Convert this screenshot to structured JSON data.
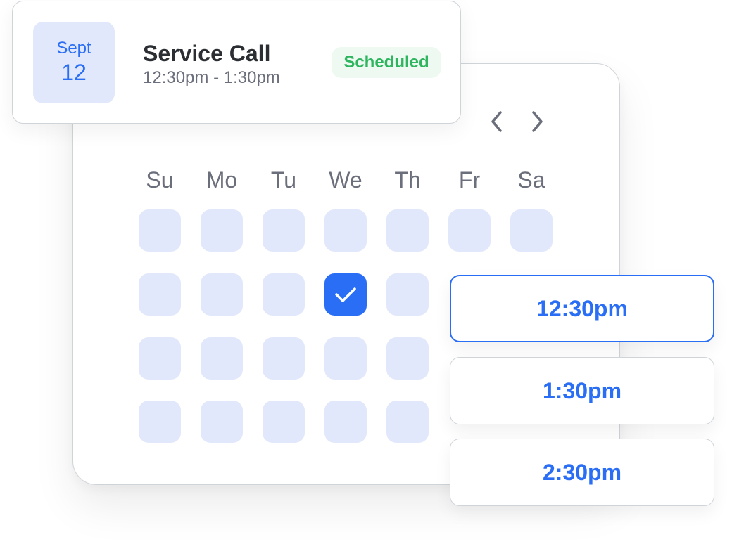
{
  "event": {
    "month": "Sept",
    "day": "12",
    "title": "Service Call",
    "time_range": "12:30pm - 1:30pm",
    "status": "Scheduled"
  },
  "calendar": {
    "nav": {
      "prev_icon": "chevron-left-icon",
      "next_icon": "chevron-right-icon"
    },
    "weekdays": [
      "Su",
      "Mo",
      "Tu",
      "We",
      "Th",
      "Fr",
      "Sa"
    ],
    "rows": [
      [
        {
          "selected": false
        },
        {
          "selected": false
        },
        {
          "selected": false
        },
        {
          "selected": false
        },
        {
          "selected": false
        },
        {
          "selected": false
        },
        {
          "selected": false
        }
      ],
      [
        {
          "selected": false
        },
        {
          "selected": false
        },
        {
          "selected": false
        },
        {
          "selected": true
        },
        {
          "selected": false
        }
      ],
      [
        {
          "selected": false
        },
        {
          "selected": false
        },
        {
          "selected": false
        },
        {
          "selected": false
        },
        {
          "selected": false
        }
      ],
      [
        {
          "selected": false
        },
        {
          "selected": false
        },
        {
          "selected": false
        },
        {
          "selected": false
        },
        {
          "selected": false
        }
      ]
    ],
    "selected_icon": "checkmark-icon"
  },
  "time_slots": [
    {
      "label": "12:30pm",
      "active": true
    },
    {
      "label": "1:30pm",
      "active": false
    },
    {
      "label": "2:30pm",
      "active": false
    }
  ],
  "colors": {
    "accent": "#2a6ef5",
    "cell_bg": "#e2e8fb",
    "status_green": "#2fb55f",
    "status_bg": "#eefaf1",
    "text_muted": "#6b6e7b"
  }
}
